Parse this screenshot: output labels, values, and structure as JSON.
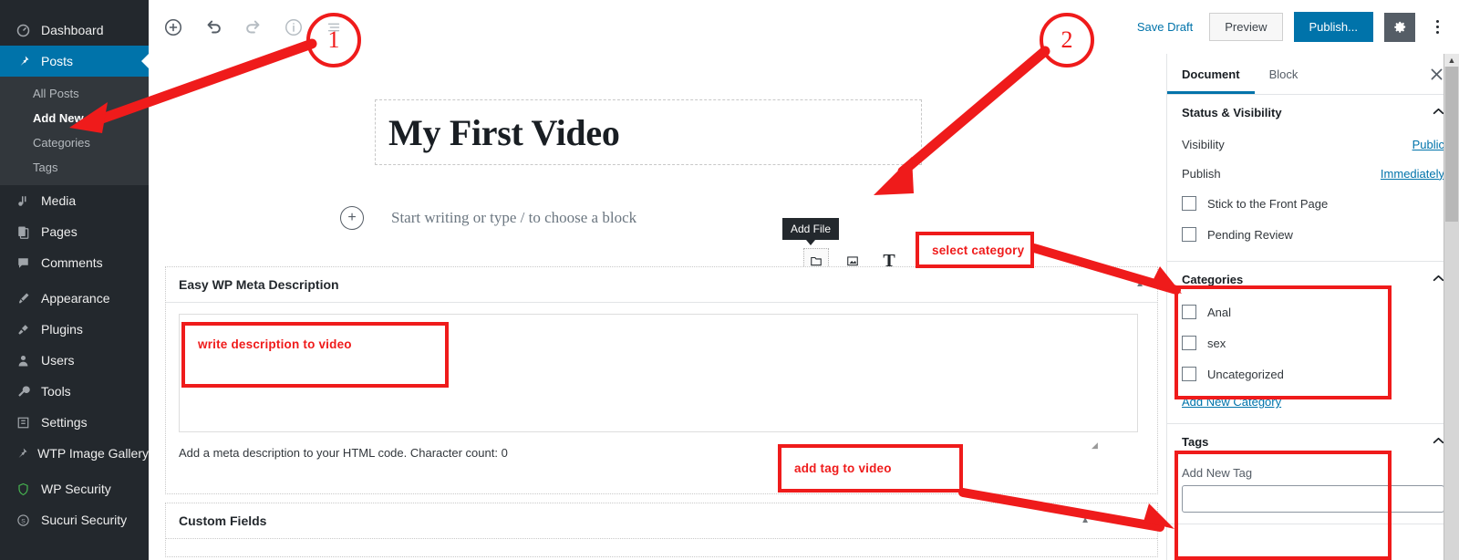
{
  "adminmenu": {
    "items": [
      {
        "label": "Dashboard",
        "icon": "dashboard-icon",
        "glyph": "☷",
        "current": false
      },
      {
        "label": "Posts",
        "icon": "pin-icon",
        "glyph": "✐",
        "current": true
      },
      {
        "label": "Media",
        "icon": "media-icon",
        "glyph": "♫",
        "current": false
      },
      {
        "label": "Pages",
        "icon": "pages-icon",
        "glyph": "❐",
        "current": false
      },
      {
        "label": "Comments",
        "icon": "comments-icon",
        "glyph": "὞9",
        "current": false
      },
      {
        "label": "Appearance",
        "icon": "brush-icon",
        "glyph": "✐",
        "current": false
      },
      {
        "label": "Plugins",
        "icon": "plug-icon",
        "glyph": "⚡",
        "current": false
      },
      {
        "label": "Users",
        "icon": "user-icon",
        "glyph": "☺",
        "current": false
      },
      {
        "label": "Tools",
        "icon": "wrench-icon",
        "glyph": "⚒",
        "current": false
      },
      {
        "label": "Settings",
        "icon": "settings-icon",
        "glyph": "⚙",
        "current": false
      },
      {
        "label": "WTP Image Gallery",
        "icon": "gallery-icon",
        "glyph": "✐",
        "current": false
      },
      {
        "label": "WP Security",
        "icon": "shield-icon",
        "glyph": "⛨",
        "current": false
      },
      {
        "label": "Sucuri Security",
        "icon": "sucuri-icon",
        "glyph": "Ⓢ",
        "current": false
      }
    ],
    "submenu": [
      {
        "label": "All Posts",
        "current": false
      },
      {
        "label": "Add New",
        "current": true
      },
      {
        "label": "Categories",
        "current": false
      },
      {
        "label": "Tags",
        "current": false
      }
    ]
  },
  "toolbar": {
    "left_buttons": [
      {
        "name": "add-block-icon",
        "label": "Add block"
      },
      {
        "name": "undo-icon",
        "label": "Undo"
      },
      {
        "name": "redo-icon",
        "label": "Redo"
      },
      {
        "name": "info-icon",
        "label": "Content structure"
      },
      {
        "name": "list-view-icon",
        "label": "Block navigation"
      }
    ],
    "save_draft": "Save Draft",
    "preview": "Preview",
    "publish": "Publish...",
    "settings_icon": "gear-icon",
    "more_icon": "kebab-menu-icon"
  },
  "editor": {
    "post_title": "My First Video",
    "paragraph_placeholder": "Start writing or type / to choose a block",
    "tooltip": "Add File",
    "quick_tools": [
      {
        "name": "file-block-icon",
        "glyph": "folder"
      },
      {
        "name": "image-block-icon",
        "glyph": "image"
      },
      {
        "name": "paragraph-block-icon",
        "glyph": "T"
      }
    ]
  },
  "metaboxes": [
    {
      "title": "Easy WP Meta Description",
      "textarea_value": "",
      "help": "Add a meta description to your HTML code. Character count: 0",
      "toggle_icon": "collapse-triangle-icon"
    },
    {
      "title": "Custom Fields",
      "toggle_icon": "collapse-triangle-icon"
    }
  ],
  "sidebar": {
    "tabs": [
      {
        "label": "Document",
        "active": true
      },
      {
        "label": "Block",
        "active": false
      }
    ],
    "close_icon": "close-icon",
    "status_panel": {
      "title": "Status & Visibility",
      "rows": [
        {
          "label": "Visibility",
          "value": "Public"
        },
        {
          "label": "Publish",
          "value": "Immediately"
        }
      ],
      "checkboxes": [
        {
          "label": "Stick to the Front Page",
          "checked": false
        },
        {
          "label": "Pending Review",
          "checked": false
        }
      ]
    },
    "categories_panel": {
      "title": "Categories",
      "items": [
        {
          "label": "Anal",
          "checked": false
        },
        {
          "label": "sex",
          "checked": false
        },
        {
          "label": "Uncategorized",
          "checked": false
        }
      ],
      "add_link": "Add New Category"
    },
    "tags_panel": {
      "title": "Tags",
      "field_label": "Add New Tag",
      "field_value": "",
      "field_placeholder": ""
    }
  },
  "annotations": {
    "marker_one": "1",
    "marker_two": "2",
    "select_category": "select category",
    "write_description": "write description  to video",
    "add_tag": "add tag to video",
    "color": "#ef1b1b"
  }
}
